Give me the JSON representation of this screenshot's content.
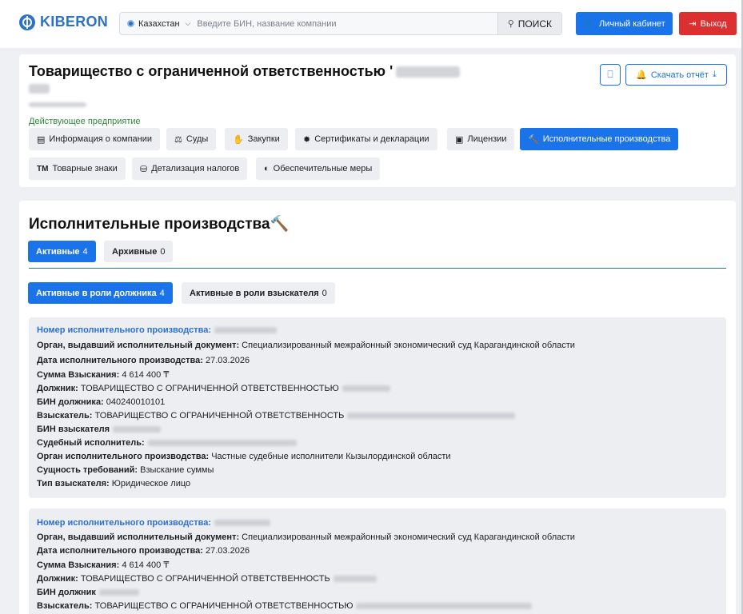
{
  "header": {
    "logo": "KIBERON",
    "country": "Казахстан",
    "search_placeholder": "Введите БИН, название компании",
    "search_button": "ПОИСК",
    "cabinet_button": "Личный кабинет",
    "exit_button": "Выход"
  },
  "company": {
    "title": "Товарищество с ограниченной ответственностью '",
    "status": "Действующее предприятие",
    "download_button": "Скачать отчёт",
    "tabs": [
      {
        "icon": "▤",
        "label": "Информация о компании"
      },
      {
        "icon": "⚖",
        "label": "Суды"
      },
      {
        "icon": "✋",
        "label": "Закупки"
      },
      {
        "icon": "✹",
        "label": "Сертификаты и декларации"
      },
      {
        "icon": "▣",
        "label": "Лицензии"
      },
      {
        "icon": "🔨",
        "label": "Исполнительные производства"
      },
      {
        "icon": "TM",
        "label": "Товарные знаки"
      },
      {
        "icon": "⛁",
        "label": "Детализация налогов"
      },
      {
        "icon": "◐",
        "label": "Обеспечительные меры"
      }
    ]
  },
  "proceedings": {
    "title": "Исполнительные производства",
    "status_tabs": [
      {
        "label": "Активные",
        "count": "4"
      },
      {
        "label": "Архивные",
        "count": "0"
      }
    ],
    "role_tabs": [
      {
        "label": "Активные в роли должника",
        "count": "4"
      },
      {
        "label": "Активные в роли взыскателя",
        "count": "0"
      }
    ],
    "records": [
      {
        "number_label": "Номер исполнительного производства:",
        "organ_label": "Орган, выдавший исполнительный документ:",
        "organ": "Специализированный межрайонный экономический суд Карагандинской области",
        "date_label": "Дата исполнительного производства:",
        "date": "27.03.2026",
        "sum_label": "Сумма Взыскания:",
        "sum": "4 614 400 ₸",
        "debtor_label": "Должник:",
        "debtor": "ТОВАРИЩЕСТВО С ОГРАНИЧЕННОЙ ОТВЕТСТВЕННОСТЬЮ",
        "debtor_bin_label": "БИН должника:",
        "debtor_bin": "040240010101",
        "claimant_label": "Взыскатель:",
        "claimant": "ТОВАРИЩЕСТВО С ОГРАНИЧЕННОЙ ОТВЕТСТВЕННОСТЬ",
        "claimant_bin_label": "БИН взыскателя",
        "bailiff_label": "Судебный исполнитель:",
        "exec_organ_label": "Орган исполнительного производства:",
        "exec_organ": "Частные судебные исполнители Кызылординской области",
        "essence_label": "Сущность требований:",
        "essence": "Взыскание суммы",
        "claimant_type_label": "Тип взыскателя:",
        "claimant_type": "Юридическое лицо"
      },
      {
        "number_label": "Номер исполнительного производства:",
        "organ_label": "Орган, выдавший исполнительный документ:",
        "organ": "Специализированный межрайонный экономический суд Карагандинской области",
        "date_label": "Дата исполнительного производства:",
        "date": "27.03.2026",
        "sum_label": "Сумма Взыскания:",
        "sum": "4 614 400 ₸",
        "debtor_label": "Должник:",
        "debtor": "ТОВАРИЩЕСТВО С ОГРАНИЧЕННОЙ ОТВЕТСТВЕННОСТЬ",
        "debtor_bin_label": "БИН должник",
        "claimant_label": "Взыскатель:",
        "claimant": "ТОВАРИЩЕСТВО С ОГРАНИЧЕННОЙ ОТВЕТСТВЕННОСТЬЮ"
      }
    ]
  },
  "colors": {
    "brand": "#2b72c9",
    "primary": "#1a73e8",
    "danger": "#dc2f2f",
    "status_green": "#2e8b3a",
    "link": "#2b6fd6"
  }
}
